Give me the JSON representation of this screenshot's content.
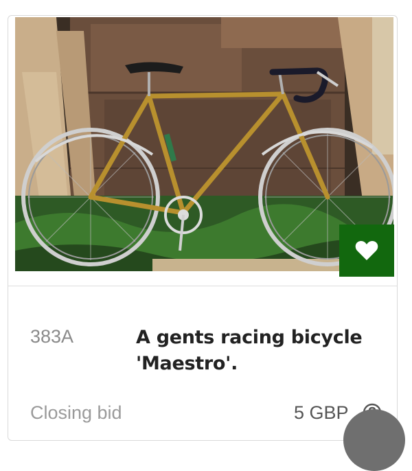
{
  "lot": {
    "number": "383A",
    "title": "A gents racing bicycle 'Maestro'."
  },
  "bid": {
    "label": "Closing bid",
    "value": "5 GBP"
  },
  "icons": {
    "favourite": "heart-icon",
    "help": "question-circle-icon"
  },
  "colors": {
    "favourite_button": "#12680e",
    "frame": "#b8902e",
    "text_dark": "#222222",
    "text_muted": "#9a9a9a"
  }
}
